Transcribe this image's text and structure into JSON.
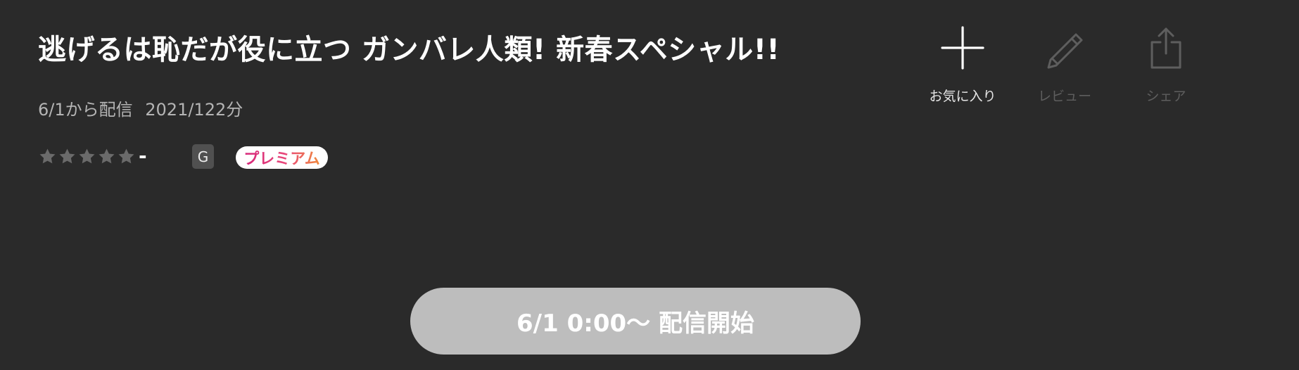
{
  "title": "逃げるは恥だが役に立つ ガンバレ人類! 新春スペシャル!!",
  "meta": {
    "availability": "6/1から配信",
    "year_duration": "2021/122分"
  },
  "rating": {
    "stars_total": 5,
    "stars_filled": 0,
    "value": "-"
  },
  "badges": {
    "age_rating": "G",
    "premium": "プレミアム"
  },
  "actions": {
    "favorite": {
      "label": "お気に入り",
      "icon": "plus-icon",
      "enabled": true
    },
    "review": {
      "label": "レビュー",
      "icon": "pencil-icon",
      "enabled": false
    },
    "share": {
      "label": "シェア",
      "icon": "share-icon",
      "enabled": false
    }
  },
  "cta": {
    "label": "6/1 0:00〜 配信開始",
    "enabled": false
  },
  "colors": {
    "background": "#2a2a2a",
    "title": "#ffffff",
    "meta_text": "#b4b4b4",
    "star_inactive": "#6a6a6a",
    "disabled_action": "#5e5e5e",
    "cta_background": "#bdbdbd",
    "premium_gradient_start": "#d6277a",
    "premium_gradient_end": "#f08a3c"
  }
}
